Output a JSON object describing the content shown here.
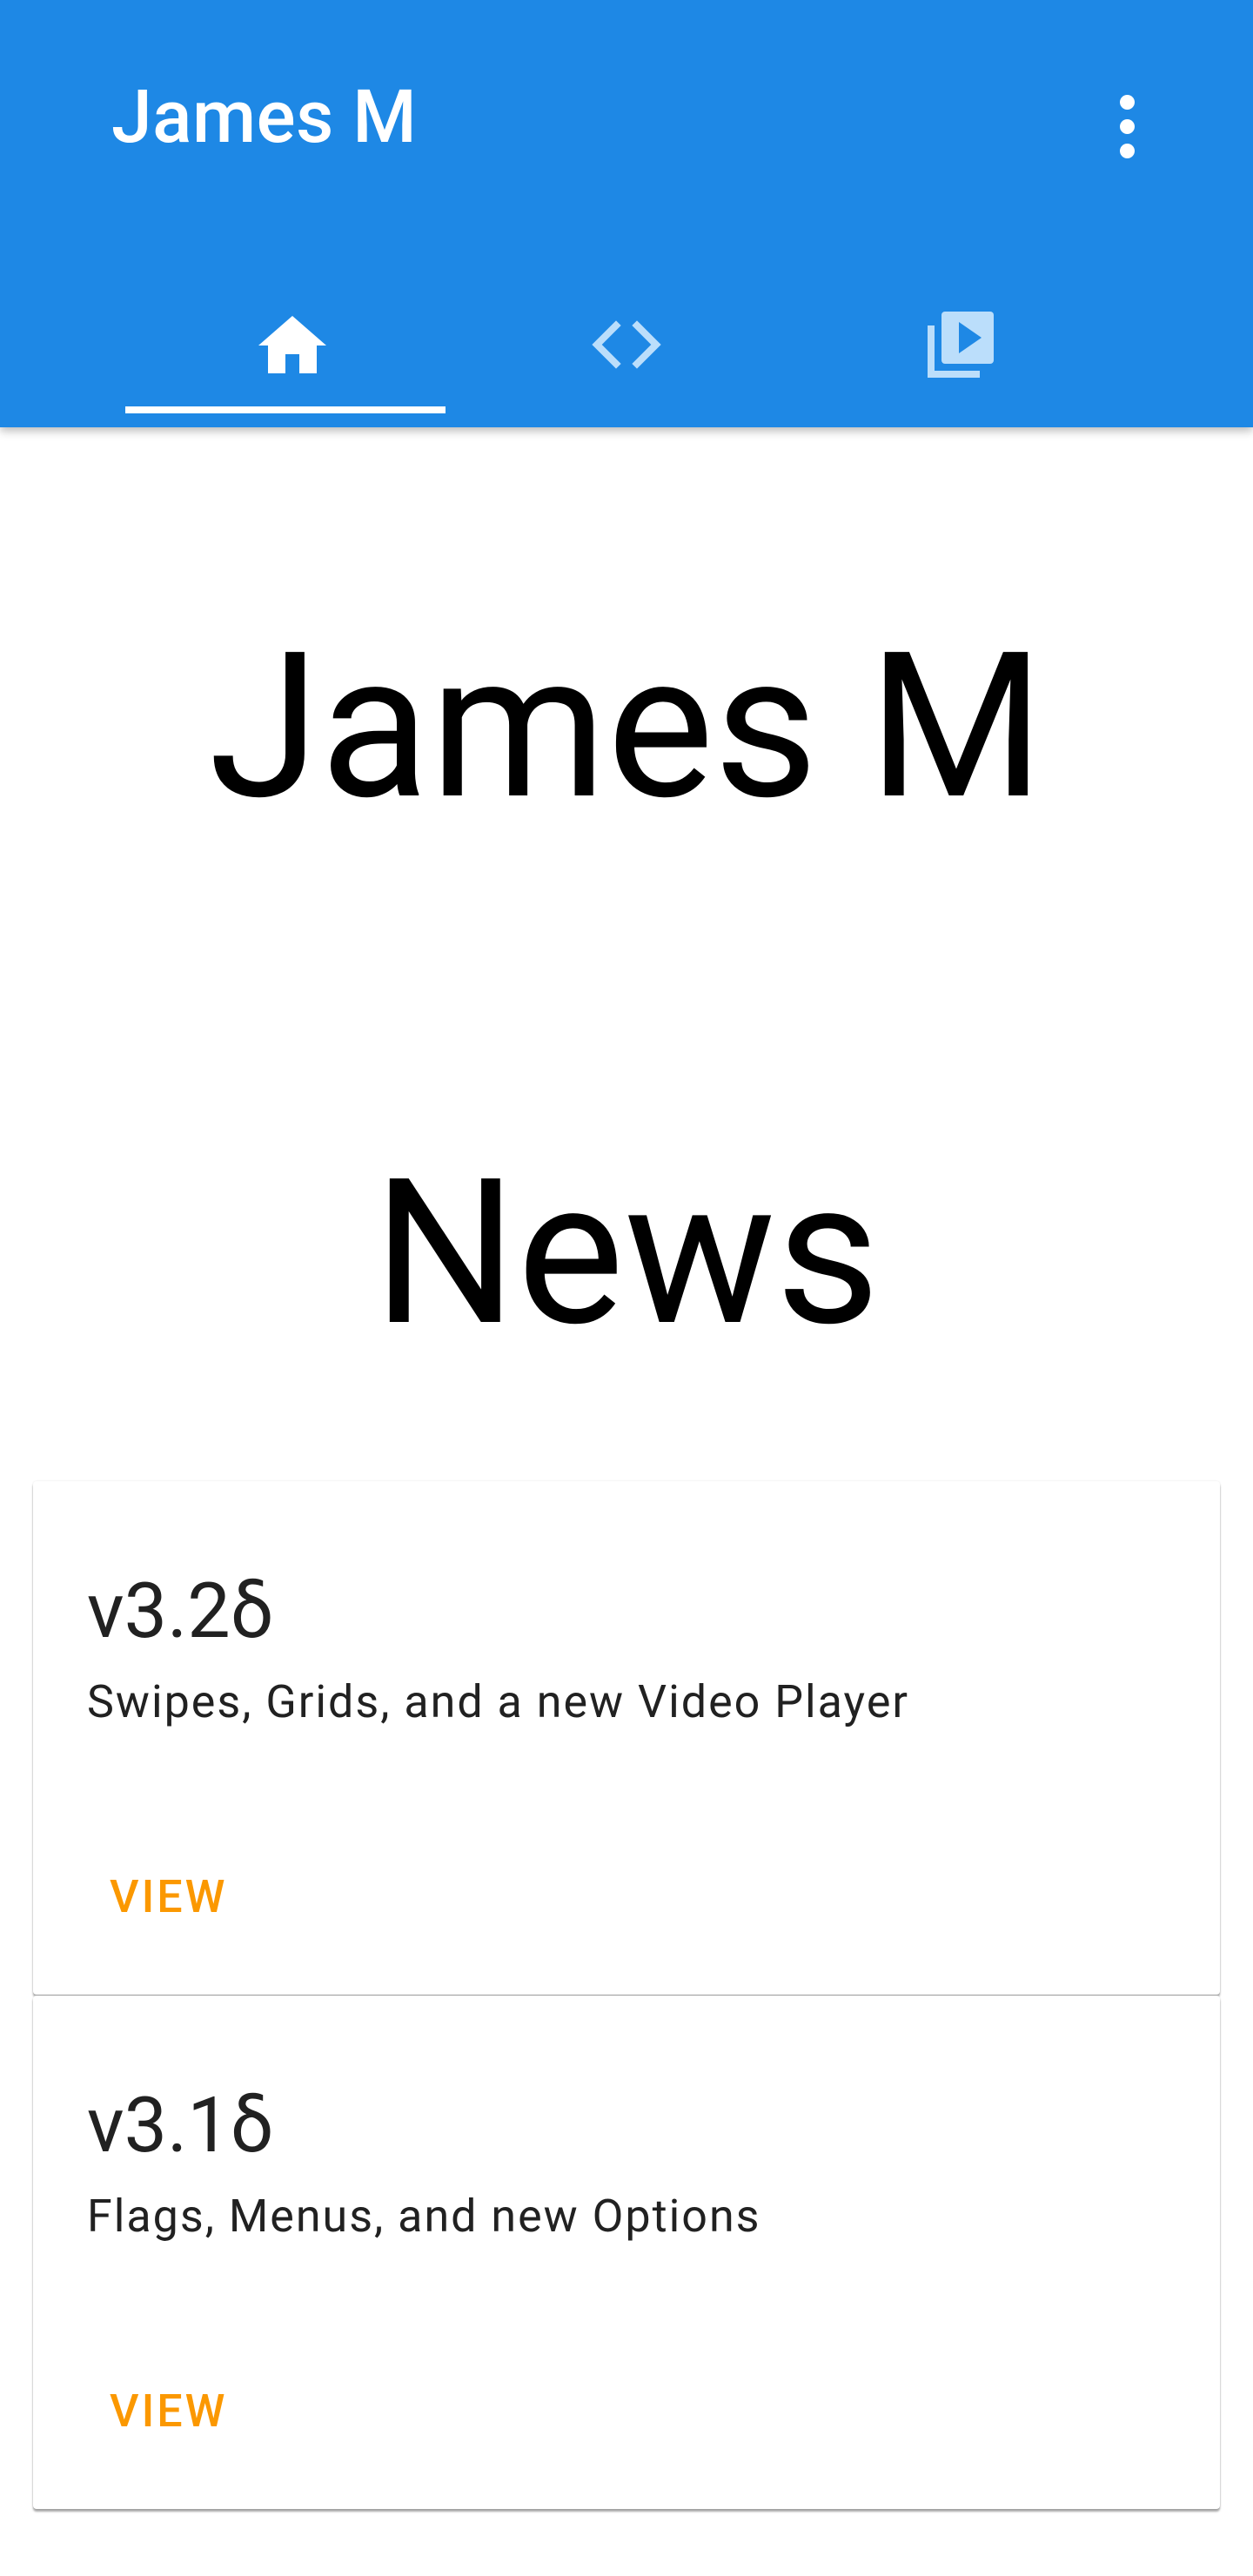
{
  "app_bar": {
    "title": "James M",
    "background_color": "#1E88E5",
    "menu_icon": "more-vert-icon",
    "tabs": [
      {
        "icon": "home-icon",
        "selected": true
      },
      {
        "icon": "code-icon",
        "selected": false
      },
      {
        "icon": "video-library-icon",
        "selected": false
      }
    ]
  },
  "main": {
    "hero_title": "James M",
    "section_title": "News",
    "news": [
      {
        "version": "v3.2δ",
        "subtitle": "Swipes, Grids, and a new Video Player",
        "action": "VIEW"
      },
      {
        "version": "v3.1δ",
        "subtitle": "Flags, Menus, and new Options",
        "action": "VIEW"
      }
    ],
    "accent_color": "#FB9800"
  }
}
